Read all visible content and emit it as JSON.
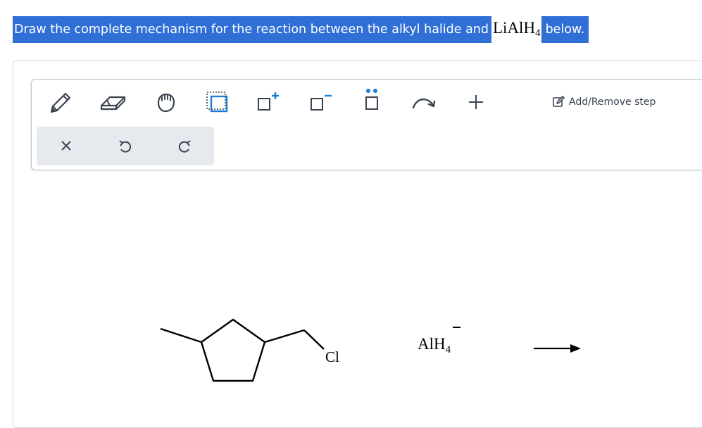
{
  "question": {
    "text_before": "Draw the complete mechanism for the reaction between the alkyl halide and",
    "reagent_main": "LiAlH",
    "reagent_sub": "4",
    "text_after": "below."
  },
  "toolbar": {
    "tools": [
      "pencil-tool",
      "eraser-tool",
      "hand-tool",
      "lone-pair-box-tool",
      "positive-charge-tool",
      "negative-charge-tool",
      "electron-pair-tool",
      "curved-arrow-tool",
      "plus-tool"
    ],
    "add_remove_label": "Add/Remove step",
    "clear_button": "clear",
    "undo_button": "undo",
    "redo_button": "redo"
  },
  "drawing": {
    "halogen_label": "Cl",
    "reagent_main": "AlH",
    "reagent_sub": "4",
    "reagent_charge": "−"
  },
  "colors": {
    "highlight": "#2f6fd6",
    "accent": "#1a7fd4",
    "icon": "#3a4350"
  }
}
